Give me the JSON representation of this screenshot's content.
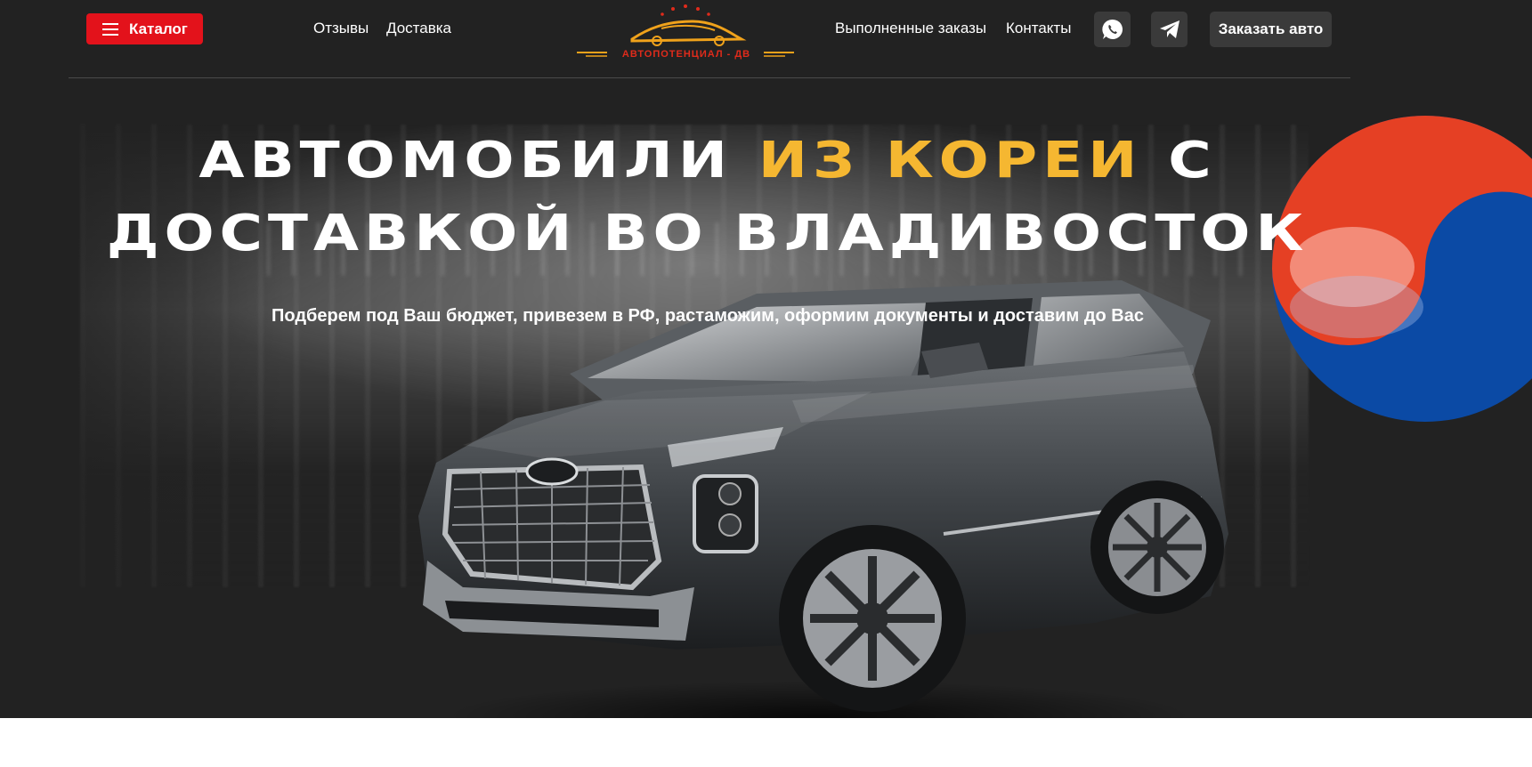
{
  "header": {
    "catalog_label": "Каталог",
    "nav_left": [
      "Отзывы",
      "Доставка"
    ],
    "logo_text": "АВТОПОТЕНЦИАЛ - ДВ",
    "nav_right": [
      "Выполненные заказы",
      "Контакты"
    ],
    "icons": [
      "whatsapp-icon",
      "telegram-icon"
    ],
    "order_label": "Заказать авто"
  },
  "hero": {
    "title_part1": "АВТОМОБИЛИ ",
    "title_accent": "ИЗ КОРЕИ",
    "title_part2": " С",
    "title_line2": "ДОСТАВКОЙ ВО ВЛАДИВОСТОК",
    "subtitle": "Подберем под Ваш бюджет, привезем в РФ, растаможим, оформим документы и доставим до Вас"
  },
  "colors": {
    "background": "#222222",
    "accent_red": "#e3121b",
    "accent_yellow": "#f5b731",
    "button_dark": "#3a3a3a",
    "flag_red": "#e54024",
    "flag_blue": "#0b4aa5"
  }
}
